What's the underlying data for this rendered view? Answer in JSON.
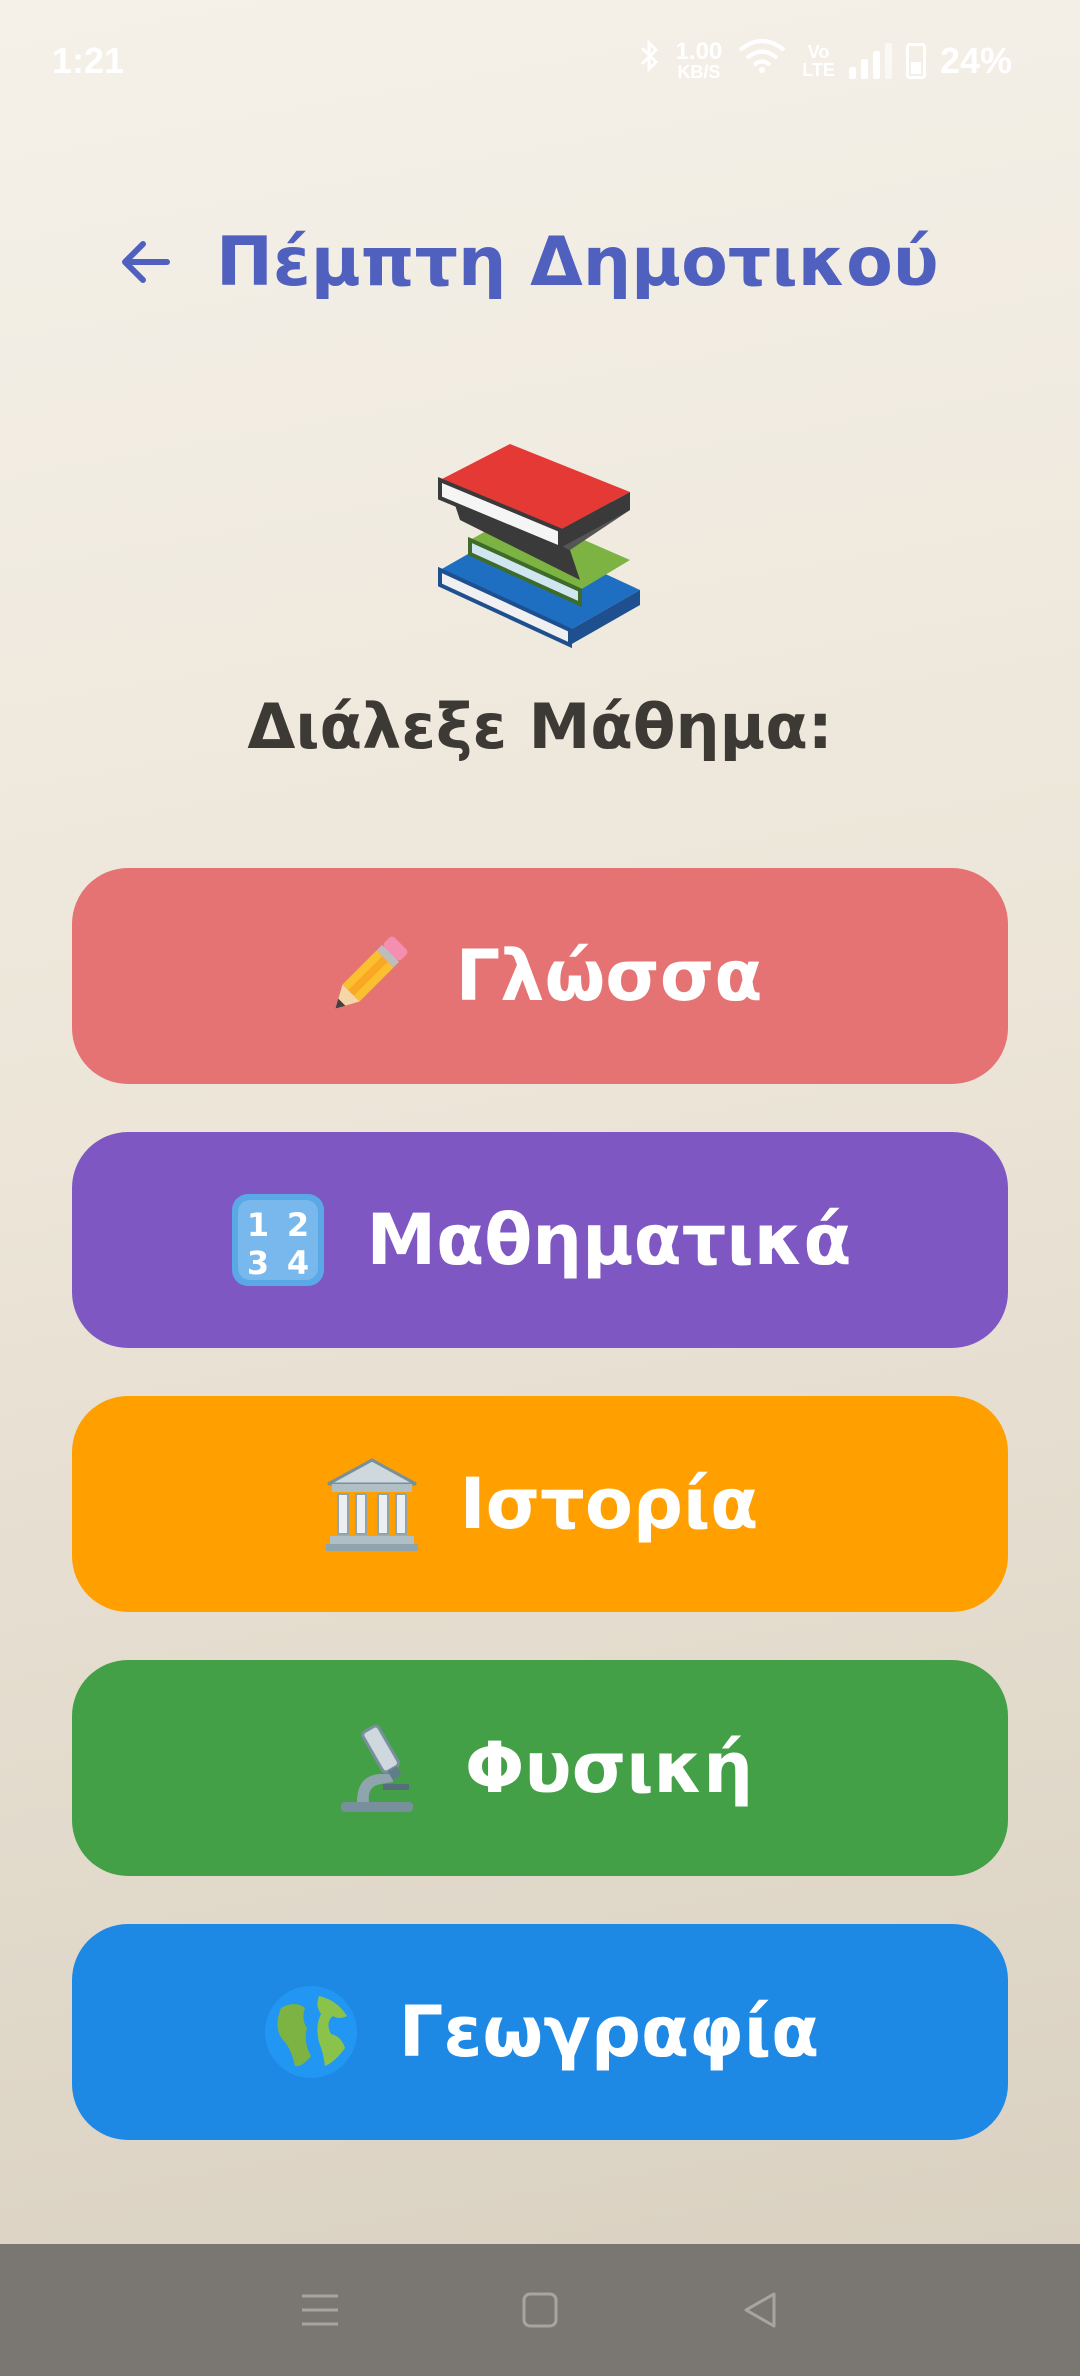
{
  "status": {
    "time": "1:21",
    "speed_value": "1.00",
    "speed_unit": "KB/S",
    "volte_top": "Vo",
    "volte_bottom": "LTE",
    "battery": "24%"
  },
  "header": {
    "title": "Πέμπτη Δημοτικού"
  },
  "prompt": "Διάλεξε Μάθημα:",
  "subjects": [
    {
      "label": "Γλώσσα",
      "icon": "pencil-icon",
      "color": "#e57373"
    },
    {
      "label": "Μαθηματικά",
      "icon": "numbers-1234-icon",
      "color": "#7e57c2"
    },
    {
      "label": "Ιστορία",
      "icon": "classical-building-icon",
      "color": "#ffa000"
    },
    {
      "label": "Φυσική",
      "icon": "microscope-icon",
      "color": "#43a047"
    },
    {
      "label": "Γεωγραφία",
      "icon": "globe-icon",
      "color": "#1e88e5"
    }
  ],
  "colors": {
    "title": "#5060bf",
    "navbar": "#7a7672"
  }
}
